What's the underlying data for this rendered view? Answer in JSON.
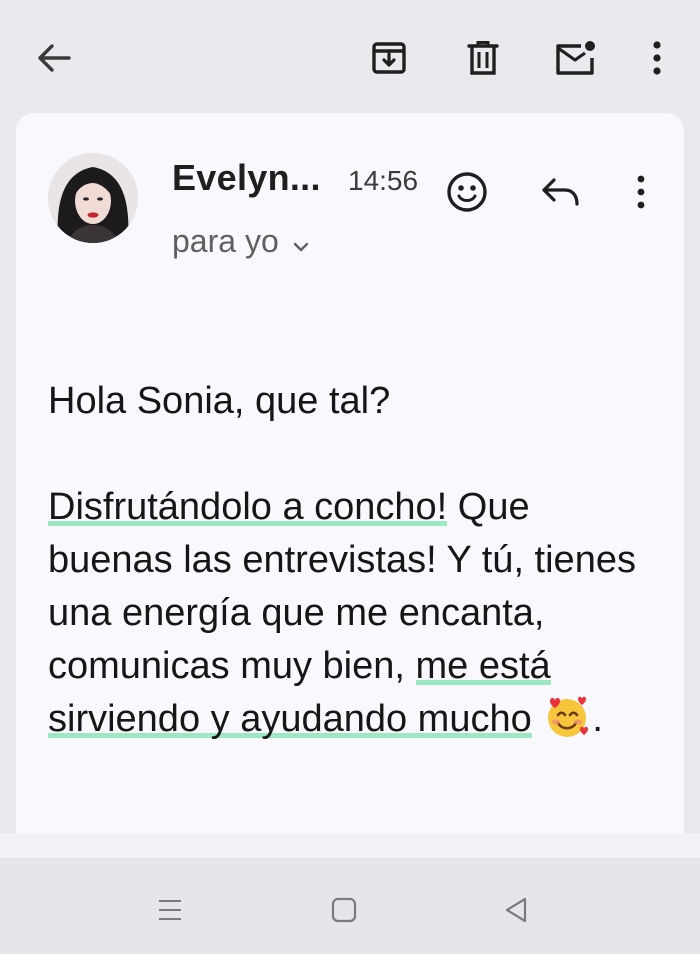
{
  "toolbar": {
    "back_icon": "arrow-left-icon",
    "archive_icon": "archive-icon",
    "delete_icon": "trash-icon",
    "mark_unread_icon": "mail-unread-icon",
    "more_icon": "more-vert-icon"
  },
  "message": {
    "sender": "Evelyn...",
    "time": "14:56",
    "recipient": "para yo",
    "greeting": "Hola Sonia, que tal?",
    "para_hl1": "Disfrutándolo a concho!",
    "para_t1": " Que buenas las entrevistas! Y tú, tienes una energía que me encanta, comunicas muy bien, ",
    "para_hl2": "me está sirviendo y ayudando mucho",
    "para_end": ".",
    "emoji": "smiling-face-with-hearts-icon"
  },
  "colors": {
    "background": "#eae9ee",
    "card": "#f9f8fd",
    "highlight": "#9be8c3",
    "text": "#161616"
  },
  "navbar": {
    "recents_icon": "menu-lines-icon",
    "home_icon": "square-icon",
    "back_icon": "triangle-back-icon"
  }
}
